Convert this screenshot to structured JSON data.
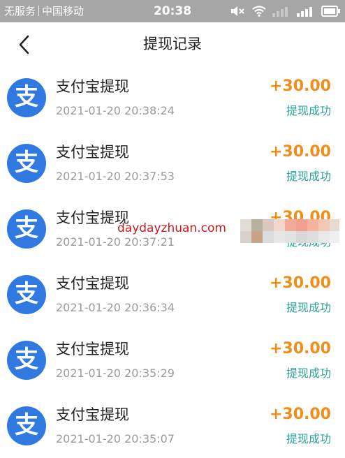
{
  "status_bar": {
    "carrier1": "无服务",
    "carrier2": "中国移动",
    "time": "20:38"
  },
  "nav": {
    "title": "提现记录"
  },
  "records": [
    {
      "title": "支付宝提现",
      "time": "2021-01-20 20:38:24",
      "amount": "+30.00",
      "status": "提现成功",
      "icon_char": "支"
    },
    {
      "title": "支付宝提现",
      "time": "2021-01-20 20:37:53",
      "amount": "+30.00",
      "status": "提现成功",
      "icon_char": "支"
    },
    {
      "title": "支付宝提现",
      "time": "2021-01-20 20:37:21",
      "amount": "+30.00",
      "status": "提现成功",
      "icon_char": "支"
    },
    {
      "title": "支付宝提现",
      "time": "2021-01-20 20:36:34",
      "amount": "+30.00",
      "status": "提现成功",
      "icon_char": "支"
    },
    {
      "title": "支付宝提现",
      "time": "2021-01-20 20:35:29",
      "amount": "+30.00",
      "status": "提现成功",
      "icon_char": "支"
    },
    {
      "title": "支付宝提现",
      "time": "2021-01-20 20:35:07",
      "amount": "+30.00",
      "status": "提现成功",
      "icon_char": "支"
    }
  ],
  "watermark": {
    "text": "daydayzhuan.com"
  },
  "colors": {
    "status_bar_bg": "#a6a6a6",
    "alipay_blue": "#2f79e0",
    "amount_orange": "#f08e1c",
    "status_teal": "#2aa39a",
    "watermark_red": "#cc1a1a"
  }
}
